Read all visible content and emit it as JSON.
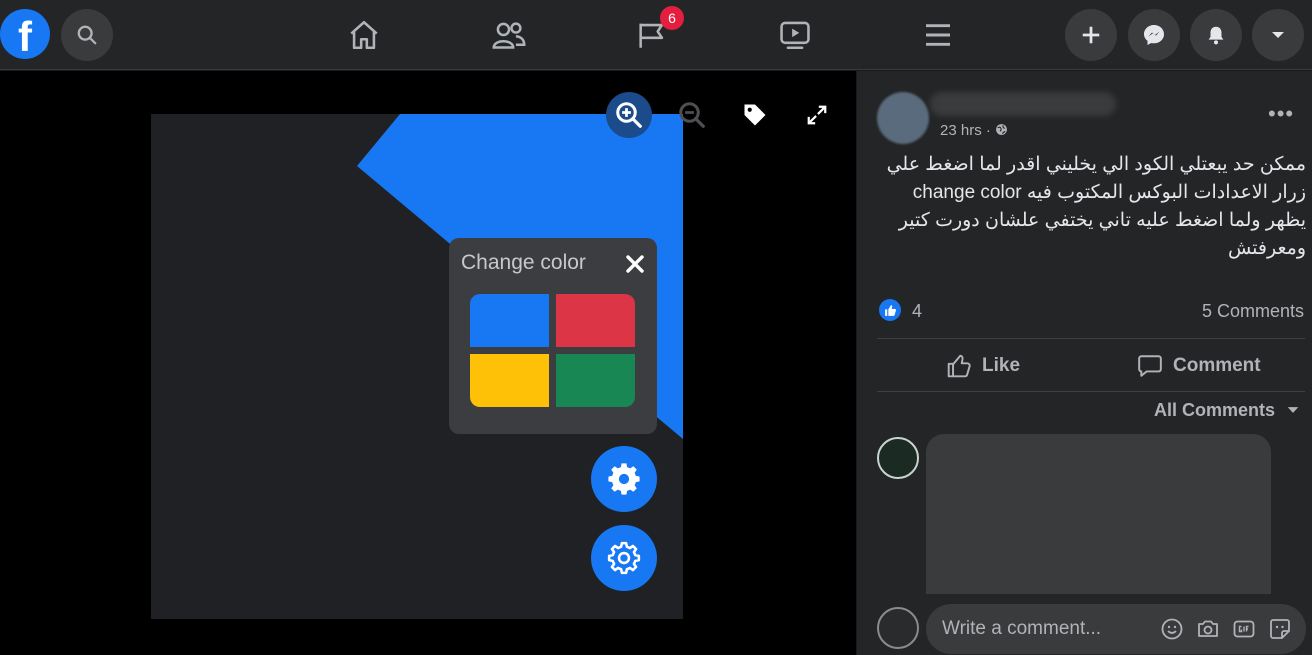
{
  "topbar": {
    "logo_letter": "f",
    "notifications_badge": "6"
  },
  "popup": {
    "title": "Change color",
    "swatches": [
      "#1877f2",
      "#dc3545",
      "#ffc107",
      "#198754"
    ]
  },
  "post": {
    "time": "23 hrs ·",
    "text": "ممكن حد يبعتلي الكود الي يخليني اقدر لما اضغط علي زرار الاعدادات البوكس المكتوب فيه change color يظهر ولما اضغط عليه تاني يختفي علشان دورت كتير ومعرفتش",
    "like_count": "4",
    "comments_count": "5 Comments",
    "like_label": "Like",
    "comment_label": "Comment",
    "all_comments_label": "All Comments"
  },
  "composer": {
    "placeholder": "Write a comment..."
  },
  "colors": {
    "accent": "#1877f2",
    "background": "#18191a",
    "surface": "#242526"
  }
}
